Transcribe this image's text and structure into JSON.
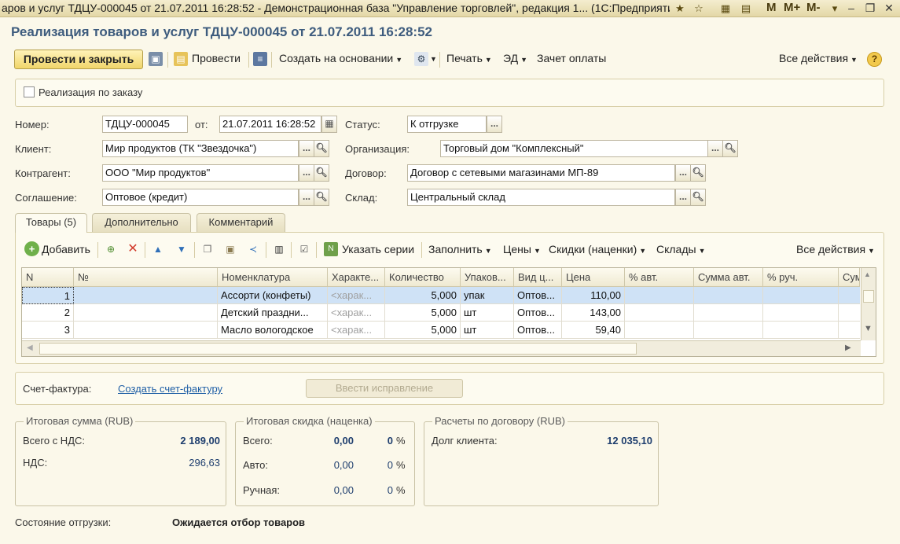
{
  "window": {
    "title": "аров и услуг ТДЦУ-000045 от 21.07.2011 16:28:52 - Демонстрационная база \"Управление торговлей\", редакция 1... (1С:Предприятие)",
    "letters": [
      "M",
      "M+",
      "M-"
    ]
  },
  "document_title": "Реализация товаров и услуг ТДЦУ-000045 от 21.07.2011 16:28:52",
  "toolbar": {
    "post_close": "Провести и закрыть",
    "post": "Провести",
    "create_based": "Создать на основании",
    "print": "Печать",
    "ed": "ЭД",
    "payment_offset": "Зачет оплаты",
    "all_actions": "Все действия"
  },
  "by_order_label": "Реализация по заказу",
  "form": {
    "number_label": "Номер:",
    "number": "ТДЦУ-000045",
    "from_label": "от:",
    "date": "21.07.2011 16:28:52",
    "status_label": "Статус:",
    "status": "К отгрузке",
    "client_label": "Клиент:",
    "client": "Мир продуктов (ТК \"Звездочка\")",
    "org_label": "Организация:",
    "org": "Торговый дом \"Комплексный\"",
    "counterparty_label": "Контрагент:",
    "counterparty": "ООО \"Мир продуктов\"",
    "contract_label": "Договор:",
    "contract": "Договор с сетевыми магазинами МП-89",
    "agreement_label": "Соглашение:",
    "agreement": "Оптовое (кредит)",
    "warehouse_label": "Склад:",
    "warehouse": "Центральный склад"
  },
  "tabs": [
    "Товары (5)",
    "Дополнительно",
    "Комментарий"
  ],
  "table_toolbar": {
    "add": "Добавить",
    "specify_series": "Указать серии",
    "fill": "Заполнить",
    "prices": "Цены",
    "discounts": "Скидки (наценки)",
    "warehouses": "Склады",
    "all_actions": "Все действия"
  },
  "table": {
    "columns": [
      "N",
      "№",
      "Номенклатура",
      "Характе...",
      "Количество",
      "Упаков...",
      "Вид ц...",
      "Цена",
      "% авт.",
      "Сумма авт.",
      "% руч.",
      "Сум"
    ],
    "rows": [
      [
        "1",
        "",
        "Ассорти (конфеты)",
        "<харак...",
        "5,000",
        "упак",
        "Оптов...",
        "110,00",
        "",
        "",
        "",
        ""
      ],
      [
        "2",
        "",
        "Детский праздни...",
        "<харак...",
        "5,000",
        "шт",
        "Оптов...",
        "143,00",
        "",
        "",
        "",
        ""
      ],
      [
        "3",
        "",
        "Масло вологодское",
        "<харак...",
        "5,000",
        "шт",
        "Оптов...",
        "59,40",
        "",
        "",
        "",
        ""
      ]
    ]
  },
  "invoice": {
    "label": "Счет-фактура:",
    "create_link": "Создать счет-фактуру",
    "correction_button": "Ввести исправление"
  },
  "totals": {
    "title": "Итоговая сумма (RUB)",
    "total_vat_label": "Всего с НДС:",
    "total_vat": "2 189,00",
    "vat_label": "НДС:",
    "vat": "296,63"
  },
  "discount": {
    "title": "Итоговая скидка (наценка)",
    "total_label": "Всего:",
    "total": "0,00",
    "total_pct": "0",
    "auto_label": "Авто:",
    "auto": "0,00",
    "auto_pct": "0",
    "manual_label": "Ручная:",
    "manual": "0,00",
    "manual_pct": "0",
    "pct_sign": "%"
  },
  "settlements": {
    "title": "Расчеты по договору (RUB)",
    "debt_label": "Долг клиента:",
    "debt": "12 035,10"
  },
  "shipment": {
    "label": "Состояние отгрузки:",
    "value": "Ожидается отбор товаров"
  }
}
